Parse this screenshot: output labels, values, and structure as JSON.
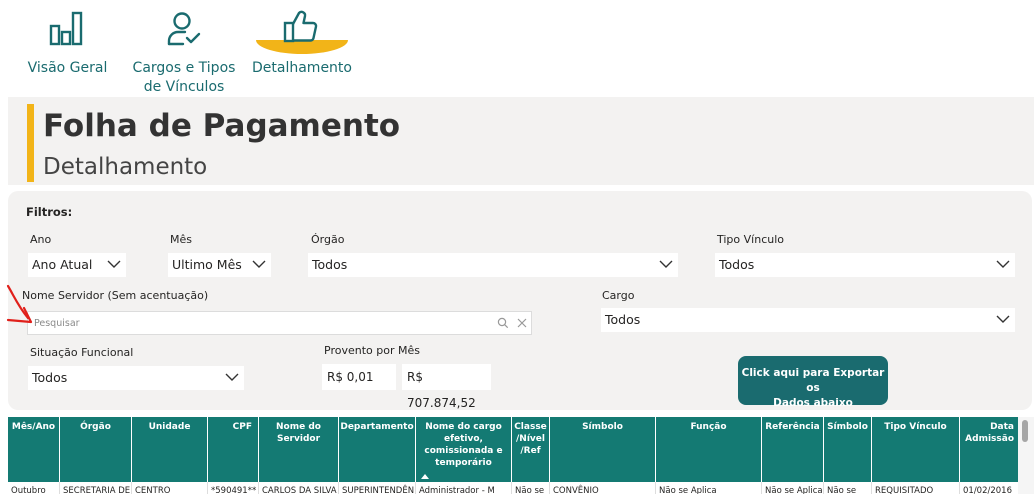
{
  "nav": {
    "items": [
      {
        "label_line1": "Visão Geral",
        "label_line2": "",
        "icon": "bar-chart-icon"
      },
      {
        "label_line1": "Cargos e Tipos",
        "label_line2": "de Vínculos",
        "icon": "user-check-icon"
      },
      {
        "label_line1": "Detalhamento",
        "label_line2": "",
        "icon": "thumbs-up-icon",
        "active": true
      }
    ],
    "color": "#1a6b6f",
    "active_color": "#f2b418"
  },
  "header": {
    "title": "Folha de Pagamento",
    "subtitle": "Detalhamento"
  },
  "filters": {
    "heading": "Filtros:",
    "ano": {
      "label": "Ano",
      "value": "Ano Atual"
    },
    "mes": {
      "label": "Mês",
      "value": "Ultimo Mês"
    },
    "orgao": {
      "label": "Órgão",
      "value": "Todos"
    },
    "tipo_vinculo": {
      "label": "Tipo Vínculo",
      "value": "Todos"
    },
    "nome_servidor": {
      "label": "Nome Servidor (Sem acentuação)",
      "placeholder": "Pesquisar"
    },
    "cargo": {
      "label": "Cargo",
      "value": "Todos"
    },
    "situacao": {
      "label": "Situação Funcional",
      "value": "Todos"
    },
    "provento": {
      "label": "Provento por Mês",
      "min": "R$ 0,01",
      "max": "R$ 707.874,52"
    },
    "export_button": {
      "line1": "Click aqui para Exportar os",
      "line2": "Dados abaixo"
    }
  },
  "table": {
    "header_color": "#147a73",
    "columns": [
      {
        "l1": "Mês/Ano",
        "l2": "",
        "l3": "",
        "l4": ""
      },
      {
        "l1": "Órgão",
        "l2": "",
        "l3": "",
        "l4": ""
      },
      {
        "l1": "Unidade",
        "l2": "",
        "l3": "",
        "l4": ""
      },
      {
        "l1": "CPF",
        "l2": "",
        "l3": "",
        "l4": ""
      },
      {
        "l1": "Nome do",
        "l2": "Servidor",
        "l3": "",
        "l4": ""
      },
      {
        "l1": "Departamento",
        "l2": "",
        "l3": "",
        "l4": ""
      },
      {
        "l1": "Nome do cargo",
        "l2": "efetivo,",
        "l3": "comissionada e",
        "l4": "temporário"
      },
      {
        "l1": "Classe",
        "l2": "/Nível",
        "l3": "/Ref",
        "l4": ""
      },
      {
        "l1": "Símbolo",
        "l2": "",
        "l3": "",
        "l4": ""
      },
      {
        "l1": "Função",
        "l2": "",
        "l3": "",
        "l4": ""
      },
      {
        "l1": "Referência",
        "l2": "",
        "l3": "",
        "l4": ""
      },
      {
        "l1": "Símbolo",
        "l2": "",
        "l3": "",
        "l4": ""
      },
      {
        "l1": "Tipo Vínculo",
        "l2": "",
        "l3": "",
        "l4": ""
      },
      {
        "l1": "Data",
        "l2": "Admissão",
        "l3": "",
        "l4": ""
      }
    ],
    "rows": [
      [
        "Outubro",
        "SECRETARIA DE",
        "CENTRO",
        "*590491**",
        "CARLOS DA SILVA",
        "SUPERINTENDÊN",
        "Administrador - M",
        "Não se",
        "CONVÊNIO",
        "Não se Aplica",
        "Não se Aplica",
        "Não se",
        "REQUISITADO",
        "01/02/2016"
      ]
    ]
  }
}
